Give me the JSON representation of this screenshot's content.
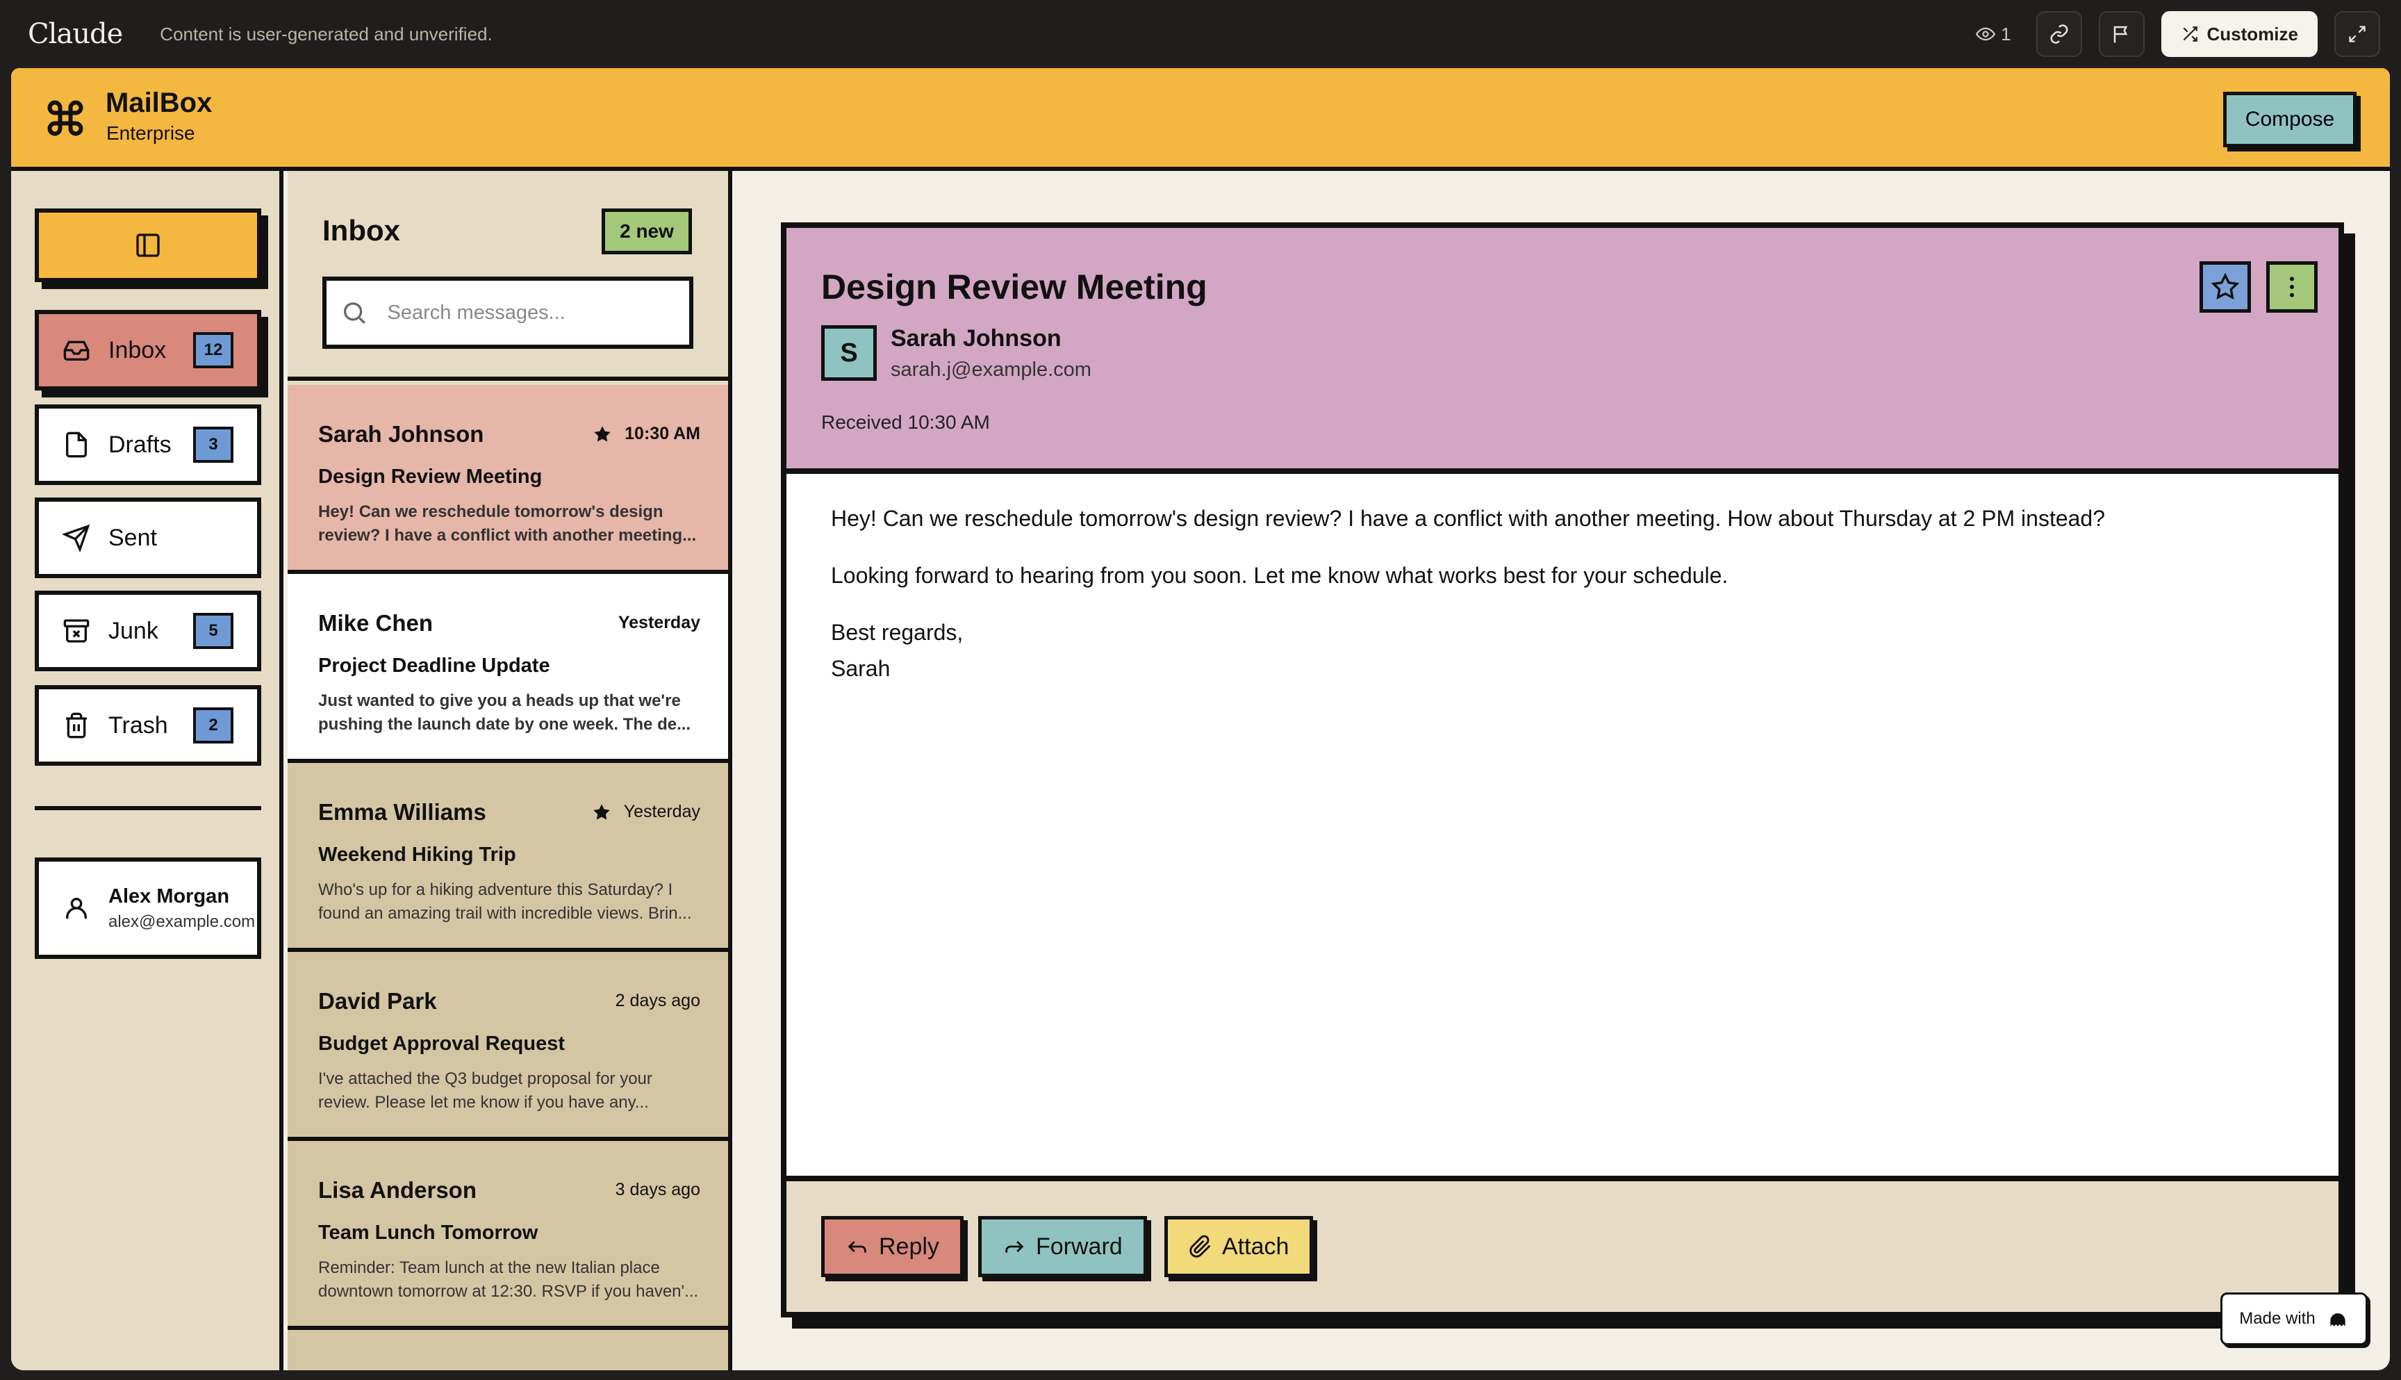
{
  "chrome": {
    "brand": "Claude",
    "notice": "Content is user-generated and unverified.",
    "view_count": "1",
    "customize_label": "Customize"
  },
  "app": {
    "title": "MailBox",
    "subtitle": "Enterprise",
    "compose_label": "Compose"
  },
  "sidebar": {
    "items": [
      {
        "label": "Inbox",
        "badge": "12",
        "icon": "inbox-icon"
      },
      {
        "label": "Drafts",
        "badge": "3",
        "icon": "file-icon"
      },
      {
        "label": "Sent",
        "badge": "",
        "icon": "send-icon"
      },
      {
        "label": "Junk",
        "badge": "5",
        "icon": "archive-x-icon"
      },
      {
        "label": "Trash",
        "badge": "2",
        "icon": "trash-icon"
      }
    ],
    "user": {
      "name": "Alex Morgan",
      "email": "alex@example.com"
    }
  },
  "list": {
    "title": "Inbox",
    "new_badge": "2 new",
    "search_placeholder": "Search messages...",
    "messages": [
      {
        "from": "Sarah Johnson",
        "time": "10:30 AM",
        "starred": true,
        "subject": "Design Review Meeting",
        "preview": "Hey! Can we reschedule tomorrow's design review? I have a conflict with another meeting...",
        "color": "#e6b6a8"
      },
      {
        "from": "Mike Chen",
        "time": "Yesterday",
        "starred": false,
        "subject": "Project Deadline Update",
        "preview": "Just wanted to give you a heads up that we're pushing the launch date by one week. The de...",
        "color": "#ffffff"
      },
      {
        "from": "Emma Williams",
        "time": "Yesterday",
        "starred": true,
        "subject": "Weekend Hiking Trip",
        "preview": "Who's up for a hiking adventure this Saturday? I found an amazing trail with incredible views. Brin...",
        "color": "#d4c6a3"
      },
      {
        "from": "David Park",
        "time": "2 days ago",
        "starred": false,
        "subject": "Budget Approval Request",
        "preview": "I've attached the Q3 budget proposal for your review. Please let me know if you have any...",
        "color": "#d4c6a3"
      },
      {
        "from": "Lisa Anderson",
        "time": "3 days ago",
        "starred": false,
        "subject": "Team Lunch Tomorrow",
        "preview": "Reminder: Team lunch at the new Italian place downtown tomorrow at 12:30. RSVP if you haven'...",
        "color": "#d4c6a3"
      }
    ]
  },
  "reader": {
    "subject": "Design Review Meeting",
    "avatar_initial": "S",
    "sender_name": "Sarah Johnson",
    "sender_email": "sarah.j@example.com",
    "received": "Received 10:30 AM",
    "body": [
      "Hey! Can we reschedule tomorrow's design review? I have a conflict with another meeting. How about Thursday at 2 PM instead?",
      "Looking forward to hearing from you soon. Let me know what works best for your schedule."
    ],
    "signoff": "Best regards,",
    "signature": "Sarah",
    "actions": {
      "reply": "Reply",
      "forward": "Forward",
      "attach": "Attach"
    }
  },
  "badge": {
    "made_with": "Made with"
  },
  "colors": {
    "header": "#f4b740",
    "sidebar_bg": "#e6dcc5",
    "active_nav": "#d9887c",
    "badge_blue": "#6f9ad6",
    "teal": "#8fc3c1",
    "green": "#a4c97a",
    "mauve": "#d3a7c3",
    "yellow": "#f2d97a"
  }
}
